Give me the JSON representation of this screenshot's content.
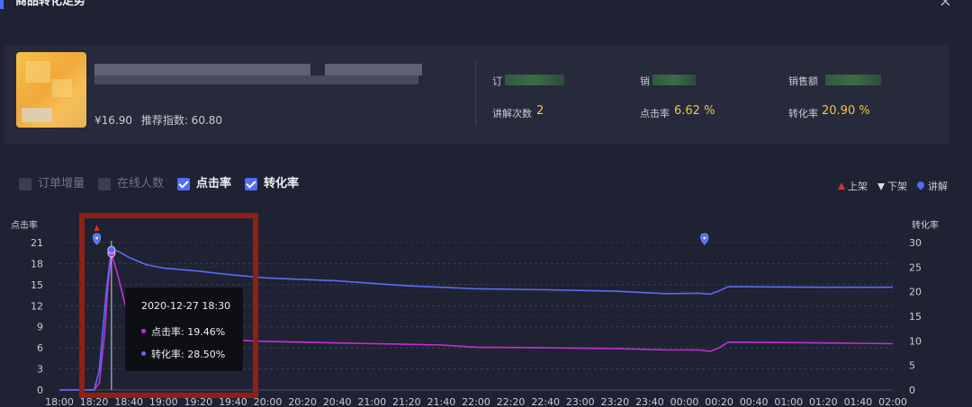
{
  "dialog": {
    "title": "商品转化走势",
    "close_glyph": "×"
  },
  "product": {
    "price": "¥16.90",
    "recommend_index_text": "推荐指数: 60.80"
  },
  "stats": {
    "orders_label": "订",
    "sales_label": "销",
    "revenue_label": "销售额",
    "explain_count_label": "讲解次数",
    "explain_count_value": "2",
    "click_rate_label": "点击率",
    "click_rate_value": "6.62 %",
    "conversion_label": "转化率",
    "conversion_value": "20.90 %"
  },
  "legend": {
    "order_increment": {
      "label": "订单增量",
      "checked": false
    },
    "online_users": {
      "label": "在线人数",
      "checked": false
    },
    "click_rate": {
      "label": "点击率",
      "checked": true
    },
    "conversion_rate": {
      "label": "转化率",
      "checked": true
    },
    "markers": {
      "on_shelf": "上架",
      "off_shelf": "下架",
      "explain": "讲解"
    }
  },
  "tooltip": {
    "time": "2020-12-27 18:30",
    "click_rate": "点击率: 19.46%",
    "conversion": "转化率: 28.50%"
  },
  "colors": {
    "accent": "#4f6cf7",
    "click_rate": "#c02fd6",
    "conversion": "#5a6cf2",
    "value": "#f5c24a",
    "on_shelf": "#e02f2f",
    "highlight": "#8f2016"
  },
  "chart_data": {
    "type": "line",
    "y_left_name": "点击率",
    "y_right_name": "转化率",
    "y_left_ticks": [
      "0",
      "3",
      "6",
      "9",
      "12",
      "15",
      "18",
      "21"
    ],
    "y_right_ticks": [
      "0",
      "5",
      "10",
      "15",
      "20",
      "25",
      "30"
    ],
    "ylim_left": [
      0,
      21
    ],
    "ylim_right": [
      0,
      30
    ],
    "x_labels": [
      "18:00",
      "18:20",
      "18:40",
      "19:00",
      "19:20",
      "19:40",
      "20:00",
      "20:20",
      "20:40",
      "21:00",
      "21:20",
      "21:40",
      "22:00",
      "22:20",
      "22:40",
      "23:00",
      "23:20",
      "23:40",
      "00:00",
      "00:20",
      "00:40",
      "01:00",
      "01:20",
      "01:40",
      "02:00"
    ],
    "x_minutes": [
      0,
      20,
      40,
      60,
      80,
      100,
      120,
      140,
      160,
      180,
      200,
      220,
      240,
      260,
      280,
      300,
      320,
      340,
      360,
      380,
      400,
      420,
      440,
      460,
      480
    ],
    "series": [
      {
        "name": "点击率",
        "axis": "left",
        "points": [
          [
            0,
            0
          ],
          [
            20,
            0
          ],
          [
            23,
            1
          ],
          [
            26,
            8
          ],
          [
            28,
            15
          ],
          [
            30,
            19.46
          ],
          [
            34,
            16
          ],
          [
            38,
            12
          ],
          [
            42,
            9.5
          ],
          [
            50,
            8.3
          ],
          [
            60,
            7.8
          ],
          [
            80,
            7.4
          ],
          [
            100,
            7.1
          ],
          [
            120,
            6.9
          ],
          [
            160,
            6.7
          ],
          [
            200,
            6.5
          ],
          [
            220,
            6.4
          ],
          [
            240,
            6.1
          ],
          [
            280,
            6.0
          ],
          [
            320,
            5.9
          ],
          [
            350,
            5.7
          ],
          [
            368,
            5.7
          ],
          [
            375,
            5.5
          ],
          [
            380,
            6
          ],
          [
            385,
            6.8
          ],
          [
            395,
            6.8
          ],
          [
            440,
            6.7
          ],
          [
            480,
            6.6
          ]
        ]
      },
      {
        "name": "转化率",
        "axis": "right",
        "points": [
          [
            0,
            0
          ],
          [
            20,
            0
          ],
          [
            23,
            4
          ],
          [
            25,
            12
          ],
          [
            27,
            20
          ],
          [
            29,
            26
          ],
          [
            30,
            28.5
          ],
          [
            34,
            28.2
          ],
          [
            40,
            27
          ],
          [
            50,
            25.5
          ],
          [
            60,
            24.8
          ],
          [
            80,
            24.2
          ],
          [
            100,
            23.4
          ],
          [
            120,
            22.8
          ],
          [
            160,
            22.2
          ],
          [
            200,
            21.2
          ],
          [
            240,
            20.6
          ],
          [
            280,
            20.4
          ],
          [
            320,
            20.1
          ],
          [
            350,
            19.6
          ],
          [
            368,
            19.7
          ],
          [
            375,
            19.5
          ],
          [
            380,
            20.2
          ],
          [
            385,
            21.0
          ],
          [
            395,
            21.0
          ],
          [
            440,
            20.9
          ],
          [
            480,
            20.9
          ]
        ]
      }
    ],
    "on_shelf_markers_min": [
      20
    ],
    "explain_markers_min": [
      20,
      370
    ],
    "hover_minute": 30
  }
}
